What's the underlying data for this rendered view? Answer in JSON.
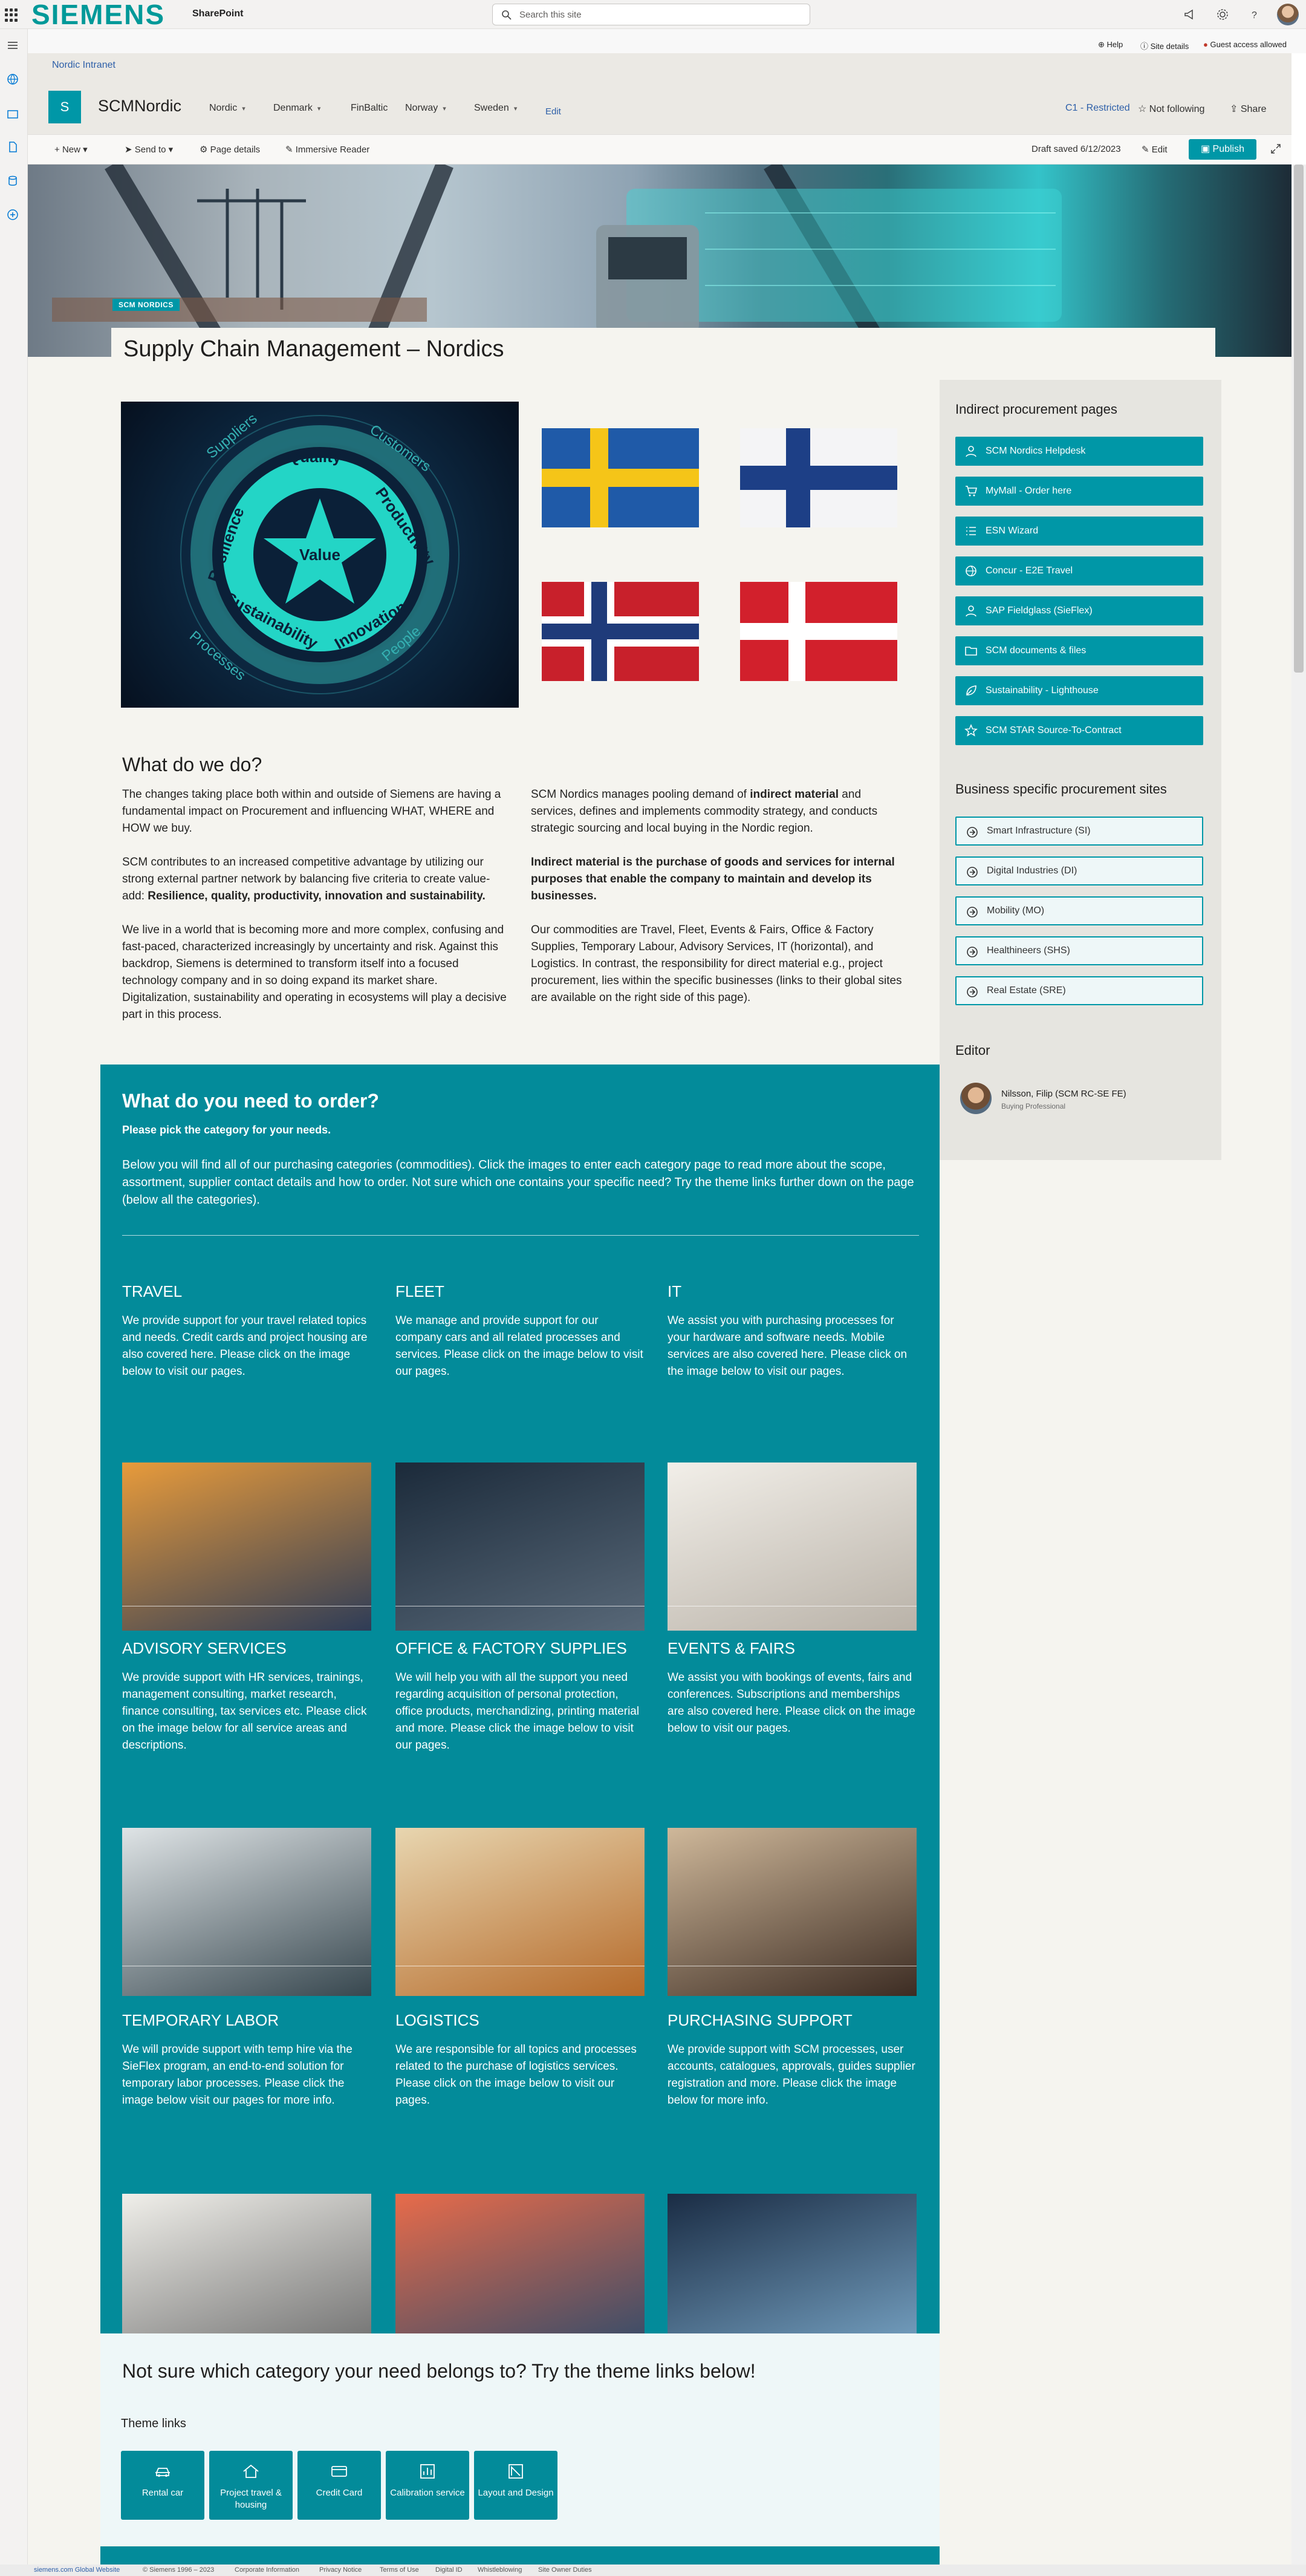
{
  "suite": {
    "brand": "SIEMENS",
    "app": "SharePoint",
    "search_placeholder": "Search this site"
  },
  "subbar": {
    "help": "Help",
    "site_details": "Site details",
    "guest": "Guest access allowed"
  },
  "breadcrumb": "Nordic Intranet",
  "site": {
    "logo_letter": "S",
    "name": "SCMNordic",
    "nav": [
      "Nordic",
      "Denmark",
      "FinBaltic",
      "Norway",
      "Sweden"
    ],
    "edit": "Edit",
    "classification": "C1 - Restricted",
    "follow": "Not following",
    "share": "Share"
  },
  "commandbar": {
    "new": "New",
    "send_to": "Send to",
    "page_details": "Page details",
    "immersive": "Immersive Reader",
    "draft": "Draft saved 6/12/2023",
    "edit": "Edit",
    "publish": "Publish"
  },
  "page": {
    "tag": "SCM NORDICS",
    "title": "Supply Chain Management – Nordics"
  },
  "value_image": {
    "outer": [
      "Suppliers",
      "Customers",
      "Processes",
      "People"
    ],
    "ring": [
      "Quality",
      "Productivity",
      "Innovation",
      "Sustainability",
      "Resilience"
    ],
    "center": "Value"
  },
  "whatdo": {
    "heading": "What do we do?",
    "left": [
      "The changes taking place both within and outside of Siemens are having a fundamental impact on Procurement and influencing WHAT, WHERE and HOW we buy.",
      "SCM contributes to an increased competitive advantage by utilizing our strong external partner network by balancing five criteria to create value-add:",
      "Resilience, quality, productivity, innovation and sustainability.",
      "We live in a world that is becoming more and more complex, confusing and fast-paced, characterized increasingly by uncertainty and risk. Against this backdrop, Siemens is determined to transform itself into a focused technology company and in so doing expand its market share. Digitalization, sustainability and operating in ecosystems will play a decisive part in this process."
    ],
    "right1_a": "SCM Nordics manages pooling demand of ",
    "right1_b": "indirect material",
    "right1_c": " and services, defines and implements commodity strategy, and conducts strategic sourcing and local buying in the Nordic region.",
    "right2": "Indirect material is the purchase of goods and services for internal purposes that enable the company to maintain and develop its businesses.",
    "right3": "Our commodities are Travel, Fleet, Events & Fairs, Office & Factory Supplies, Temporary Labour, Advisory Services, IT (horizontal), and Logistics. In contrast, the responsibility for direct material e.g., project procurement, lies within the specific businesses (links to their global sites are available on the right side of this page)."
  },
  "order": {
    "heading": "What do you need to order?",
    "sub": "Please pick the category for your needs.",
    "intro": "Below you will find all of our purchasing categories (commodities). Click the images to enter each category page to read more about the scope, assortment, supplier contact details and how to order. Not sure which one contains your specific need? Try the theme links further down on the page (below all the categories).",
    "categories": [
      {
        "title": "TRAVEL",
        "desc": "We provide support for your travel related topics and needs. Credit cards and project housing are also covered here. Please click on the image below to visit our pages.",
        "image": "high-speed train at sunset"
      },
      {
        "title": "FLEET",
        "desc": "We manage and provide support for our company cars and all related processes and services. Please click on the image below to visit our pages.",
        "image": "electric car at charging station"
      },
      {
        "title": "IT",
        "desc": "We assist you with purchasing processes for your hardware and software needs. Mobile services are also covered here. Please click on the image below to visit our pages.",
        "image": "hands typing on laptop"
      },
      {
        "title": "ADVISORY SERVICES",
        "desc": "We provide support with HR services, trainings, management consulting, market research, finance consulting, tax services etc. Please click on the image below for all service areas and descriptions.",
        "image": "people at whiteboard"
      },
      {
        "title": "OFFICE & FACTORY SUPPLIES",
        "desc": "We will help you with all the support you need regarding acquisition of personal protection, office products, merchandizing, printing material and more. Please click the image below to visit our pages.",
        "image": "worker with hard hat"
      },
      {
        "title": "EVENTS & FAIRS",
        "desc": "We assist you with bookings of events, fairs and conferences. Subscriptions and memberships are also covered here. Please click on the image below to visit our pages.",
        "image": "audience clapping"
      },
      {
        "title": "TEMPORARY LABOR",
        "desc": "We will provide support with temp hire via the SieFlex program, an end-to-end solution for temporary labor processes. Please click the image below visit our pages for more info.",
        "image": "seated group of people"
      },
      {
        "title": "LOGISTICS",
        "desc": "We are responsible for all topics and processes related to the purchase of logistics services. Please click on the image below to visit our pages.",
        "image": "plane truck and containers"
      },
      {
        "title": "PURCHASING SUPPORT",
        "desc": "We provide support with SCM processes, user accounts, catalogues, approvals, guides supplier registration and more. Please click the image below for more info.",
        "image": "people at screens"
      }
    ]
  },
  "themes": {
    "heading": "Not sure which category your need belongs to? Try the theme links below!",
    "label": "Theme links",
    "items": [
      {
        "label": "Rental car",
        "icon": "car-icon"
      },
      {
        "label": "Project travel & housing",
        "icon": "house-icon"
      },
      {
        "label": "Credit Card",
        "icon": "credit-card-icon"
      },
      {
        "label": "Calibration service",
        "icon": "chart-icon"
      },
      {
        "label": "Layout and Design",
        "icon": "design-icon"
      }
    ]
  },
  "sidebar": {
    "indirect_heading": "Indirect procurement pages",
    "indirect": [
      {
        "label": "SCM Nordics Helpdesk",
        "icon": "person-icon"
      },
      {
        "label": "MyMall - Order here",
        "icon": "cart-icon"
      },
      {
        "label": "ESN Wizard",
        "icon": "list-icon"
      },
      {
        "label": "Concur - E2E Travel",
        "icon": "globe-icon"
      },
      {
        "label": "SAP Fieldglass (SieFlex)",
        "icon": "person-icon"
      },
      {
        "label": "SCM documents & files",
        "icon": "folder-icon"
      },
      {
        "label": "Sustainability - Lighthouse",
        "icon": "leaf-icon"
      },
      {
        "label": "SCM STAR Source-To-Contract",
        "icon": "star-icon"
      }
    ],
    "business_heading": "Business specific procurement sites",
    "business": [
      {
        "label": "Smart Infrastructure (SI)"
      },
      {
        "label": "Digital Industries (DI)"
      },
      {
        "label": "Mobility (MO)"
      },
      {
        "label": "Healthineers (SHS)"
      },
      {
        "label": "Real Estate (SRE)"
      }
    ],
    "editor_heading": "Editor",
    "editor_name": "Nilsson, Filip (SCM RC-SE FE)",
    "editor_role": "Buying Professional"
  },
  "footer": [
    "siemens.com Global Website",
    "© Siemens 1996 – 2023",
    "Corporate Information",
    "Privacy Notice",
    "Terms of Use",
    "Digital ID",
    "Whistleblowing",
    "Site Owner Duties"
  ],
  "colors": {
    "teal": "#038b9a",
    "siemens": "#009999"
  }
}
